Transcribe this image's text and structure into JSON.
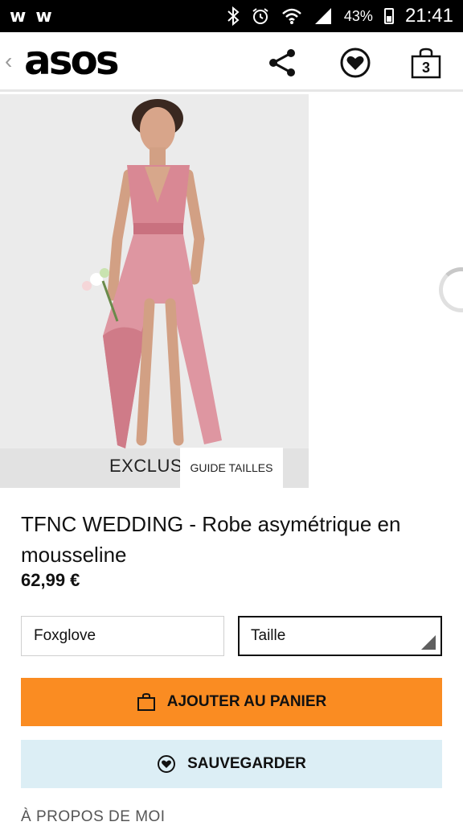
{
  "status_bar": {
    "left_icons": [
      "w",
      "w"
    ],
    "battery": "43%",
    "time": "21:41"
  },
  "header": {
    "logo": "asos",
    "back_icon": "chevron-left-icon",
    "cart_count": "3"
  },
  "product": {
    "image_labels": {
      "exclusive": "EXCLUSIV",
      "guide": "GUIDE TAILLES"
    },
    "title": "TFNC WEDDING - Robe asymétrique en mousseline",
    "price": "62,99 €",
    "color": "Foxglove",
    "size": "Taille"
  },
  "actions": {
    "add_to_cart": "AJOUTER AU PANIER",
    "save": "SAUVEGARDER"
  },
  "about": "À PROPOS DE MOI",
  "colors": {
    "accent": "#fa8c22",
    "save_bg": "#dceef5",
    "dress": "#d98894"
  }
}
